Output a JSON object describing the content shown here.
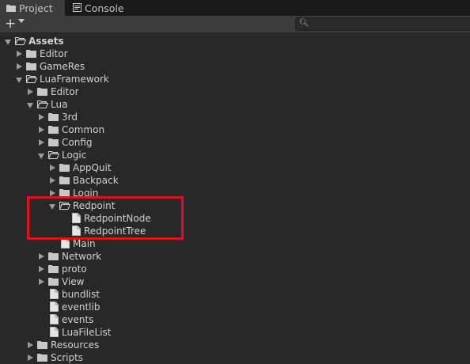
{
  "tabs": [
    {
      "label": "Project",
      "icon": "folder-icon",
      "active": true
    },
    {
      "label": "Console",
      "icon": "console-icon",
      "active": false
    }
  ],
  "toolbar": {
    "add_label": "+",
    "search_placeholder": ""
  },
  "tree": [
    {
      "label": "Assets",
      "depth": 0,
      "expanded": true,
      "type": "folder",
      "bold": true
    },
    {
      "label": "Editor",
      "depth": 1,
      "expanded": false,
      "type": "folder"
    },
    {
      "label": "GameRes",
      "depth": 1,
      "expanded": false,
      "type": "folder"
    },
    {
      "label": "LuaFramework",
      "depth": 1,
      "expanded": true,
      "type": "folder"
    },
    {
      "label": "Editor",
      "depth": 2,
      "expanded": false,
      "type": "folder"
    },
    {
      "label": "Lua",
      "depth": 2,
      "expanded": true,
      "type": "folder"
    },
    {
      "label": "3rd",
      "depth": 3,
      "expanded": false,
      "type": "folder"
    },
    {
      "label": "Common",
      "depth": 3,
      "expanded": false,
      "type": "folder"
    },
    {
      "label": "Config",
      "depth": 3,
      "expanded": false,
      "type": "folder"
    },
    {
      "label": "Logic",
      "depth": 3,
      "expanded": true,
      "type": "folder"
    },
    {
      "label": "AppQuit",
      "depth": 4,
      "expanded": false,
      "type": "folder"
    },
    {
      "label": "Backpack",
      "depth": 4,
      "expanded": false,
      "type": "folder"
    },
    {
      "label": "Login",
      "depth": 4,
      "expanded": false,
      "type": "folder"
    },
    {
      "label": "Redpoint",
      "depth": 4,
      "expanded": true,
      "type": "folder"
    },
    {
      "label": "RedpointNode",
      "depth": 5,
      "type": "file"
    },
    {
      "label": "RedpointTree",
      "depth": 5,
      "type": "file"
    },
    {
      "label": "Main",
      "depth": 4,
      "type": "file"
    },
    {
      "label": "Network",
      "depth": 3,
      "expanded": false,
      "type": "folder"
    },
    {
      "label": "proto",
      "depth": 3,
      "expanded": false,
      "type": "folder"
    },
    {
      "label": "View",
      "depth": 3,
      "expanded": false,
      "type": "folder"
    },
    {
      "label": "bundlist",
      "depth": 3,
      "type": "file"
    },
    {
      "label": "eventlib",
      "depth": 3,
      "type": "file"
    },
    {
      "label": "events",
      "depth": 3,
      "type": "file"
    },
    {
      "label": "LuaFileList",
      "depth": 3,
      "type": "file"
    },
    {
      "label": "Resources",
      "depth": 2,
      "expanded": false,
      "type": "folder"
    },
    {
      "label": "Scripts",
      "depth": 2,
      "expanded": false,
      "type": "folder"
    }
  ],
  "colors": {
    "highlight": "#e0111c",
    "background": "#282828",
    "tab_active": "#3c3c3c"
  }
}
